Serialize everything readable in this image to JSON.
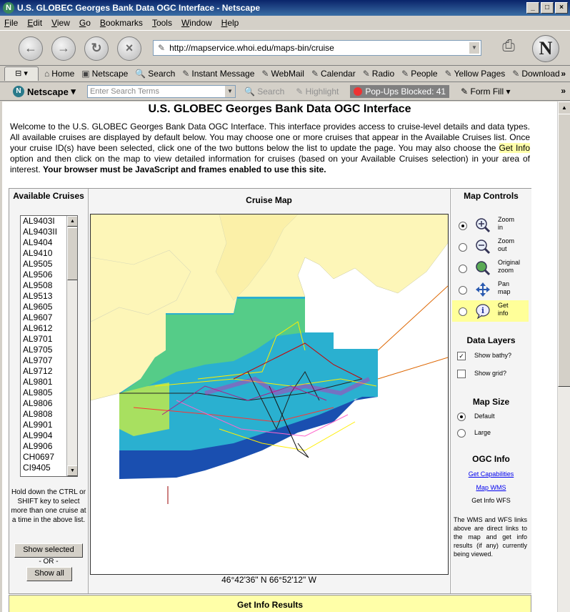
{
  "window": {
    "title": "U.S. GLOBEC Georges Bank Data OGC Interface - Netscape",
    "logo": "N"
  },
  "menu": [
    "File",
    "Edit",
    "View",
    "Go",
    "Bookmarks",
    "Tools",
    "Window",
    "Help"
  ],
  "url": "http://mapservice.whoi.edu/maps-bin/cruise",
  "personal_bar": [
    "Home",
    "Netscape",
    "Search",
    "Instant Message",
    "WebMail",
    "Calendar",
    "Radio",
    "People",
    "Yellow Pages",
    "Download"
  ],
  "search_bar": {
    "brand": "Netscape",
    "placeholder": "Enter Search Terms",
    "search": "Search",
    "highlight": "Highlight",
    "popups": "Pop-Ups Blocked: 41",
    "formfill": "Form Fill"
  },
  "page": {
    "title": "U.S. GLOBEC Georges Bank Data OGC Interface",
    "intro_1": "Welcome to the U.S. GLOBEC Georges Bank Data OGC Interface. This interface provides access to cruise-level details and data types. All available cruises are displayed by default below. You may choose one or more cruises that appear in the Available Cruises list. Once your cruise ID(s) have been selected, click one of the two buttons below the list to update the page. You may also choose the ",
    "intro_hl": "Get Info",
    "intro_2": " option and then click on the map to view detailed information for cruises (based on your Available Cruises selection) in your area of interest. ",
    "intro_bold": "Your browser must be JavaScript and frames enabled to use this site."
  },
  "cruises": {
    "title": "Available Cruises",
    "items": [
      "AL9403I",
      "AL9403II",
      "AL9404",
      "AL9410",
      "AL9505",
      "AL9506",
      "AL9508",
      "AL9513",
      "AL9605",
      "AL9607",
      "AL9612",
      "AL9701",
      "AL9705",
      "AL9707",
      "AL9712",
      "AL9801",
      "AL9805",
      "AL9806",
      "AL9808",
      "AL9901",
      "AL9904",
      "AL9906",
      "CH0697",
      "CI9405"
    ],
    "hint": "Hold down the CTRL or SHIFT key to select more than one cruise at a time in the above list.",
    "show_selected": "Show selected",
    "or": "- OR -",
    "show_all": "Show all"
  },
  "map": {
    "title": "Cruise Map",
    "coords": "46°42'36\" N 66°52'12\" W"
  },
  "controls": {
    "title": "Map Controls",
    "items": [
      {
        "label": "Zoom in",
        "icon": "zoom-in-icon",
        "checked": true
      },
      {
        "label": "Zoom out",
        "icon": "zoom-out-icon",
        "checked": false
      },
      {
        "label": "Original zoom",
        "icon": "original-zoom-icon",
        "checked": false
      },
      {
        "label": "Pan map",
        "icon": "pan-icon",
        "checked": false
      },
      {
        "label": "Get info",
        "icon": "info-icon",
        "checked": false
      }
    ]
  },
  "layers": {
    "title": "Data Layers",
    "bathy": "Show bathy?",
    "grid": "Show grid?"
  },
  "mapsize": {
    "title": "Map Size",
    "default": "Default",
    "large": "Large"
  },
  "ogc": {
    "title": "OGC Info",
    "get_capabilities": "Get Capabilities",
    "map_wms": "Map WMS",
    "get_info_wfs": "Get Info WFS",
    "note": "The WMS and WFS links above are direct links to the map and get info results (if any) currently being viewed."
  },
  "results": {
    "title": "Get Info Results"
  },
  "colors": {
    "land": "#fdf6b8",
    "water": "#ffffff",
    "highlight": "#ffff99",
    "link": "#0000ee"
  }
}
